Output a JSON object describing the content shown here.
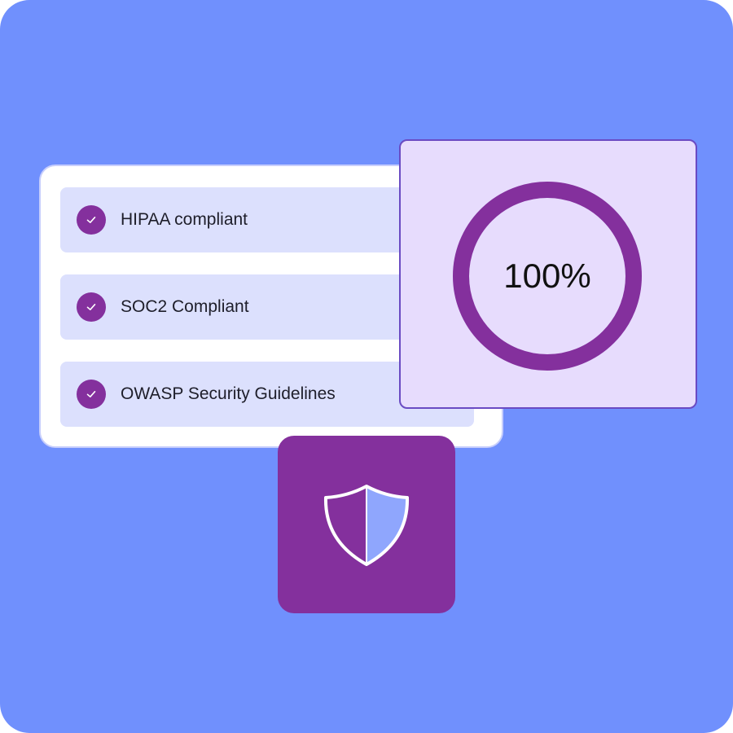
{
  "colors": {
    "background": "#7090fd",
    "row_background": "#dce0fd",
    "accent_purple": "#84309d",
    "progress_card_background": "#e7dcfd",
    "shield_fill": "#8fa6fd"
  },
  "checklist": {
    "items": [
      {
        "label": "HIPAA compliant",
        "icon": "check-icon",
        "checked": true
      },
      {
        "label": "SOC2 Compliant",
        "icon": "check-icon",
        "checked": true
      },
      {
        "label": "OWASP Security Guidelines",
        "icon": "check-icon",
        "checked": true
      }
    ]
  },
  "progress": {
    "label": "100%",
    "value": 1.0
  },
  "shield": {
    "icon": "shield-icon"
  }
}
